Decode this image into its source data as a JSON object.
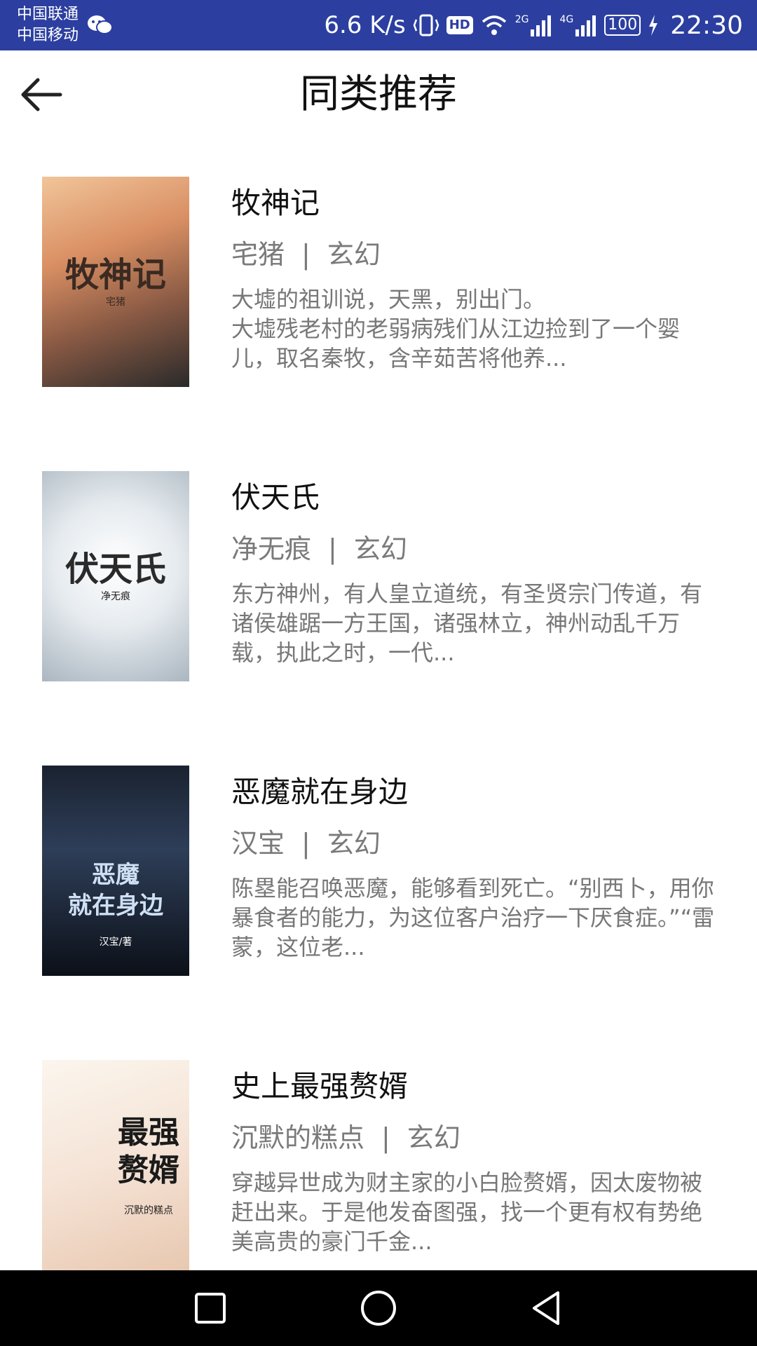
{
  "status_bar": {
    "carrier1": "中国联通",
    "carrier2": "中国移动",
    "speed": "6.6 K/s",
    "battery": "100",
    "time": "22:30",
    "hd_badge": "HD",
    "signal_2g": "2G",
    "signal_4g": "4G",
    "icons": [
      "wechat-icon",
      "vibrate-icon",
      "hd-icon",
      "wifi-icon",
      "signal-icon",
      "battery-icon",
      "charging-icon"
    ]
  },
  "header": {
    "title": "同类推荐",
    "back_icon": "arrow-left-icon"
  },
  "books": [
    {
      "title": "牧神记",
      "author": "宅猪",
      "separator": "|",
      "genre": "玄幻",
      "desc": "大墟的祖训说，天黑，别出门。\n大墟残老村的老弱病残们从江边捡到了一个婴儿，取名秦牧，含辛茹苦将他养...",
      "cover_text": "牧神记",
      "cover_author": "宅猪",
      "cover_colors": [
        "#e9b07a",
        "#b86a4a",
        "#2a2a2a"
      ]
    },
    {
      "title": "伏天氏",
      "author": "净无痕",
      "separator": "|",
      "genre": "玄幻",
      "desc": "东方神州，有人皇立道统，有圣贤宗门传道，有诸侯雄踞一方王国，诸强林立，神州动乱千万载，执此之时，一代...",
      "cover_text": "伏天氏",
      "cover_author": "净无痕",
      "cover_colors": [
        "#f2f4f6",
        "#c9d1d8",
        "#8a98a4"
      ]
    },
    {
      "title": "恶魔就在身边",
      "author": "汉宝",
      "separator": "|",
      "genre": "玄幻",
      "desc": "陈塁能召唤恶魔，能够看到死亡。“别西卜，用你暴食者的能力，为这位客户治疗一下厌食症。”“雷蒙，这位老...",
      "cover_text": "恶魔\n就在身边",
      "cover_author": "汉宝/著",
      "cover_colors": [
        "#0c1018",
        "#2a3a52",
        "#9fb8d8"
      ]
    },
    {
      "title": "史上最强赘婿",
      "author": "沉默的糕点",
      "separator": "|",
      "genre": "玄幻",
      "desc": "穿越异世成为财主家的小白脸赘婿，因太废物被赶出来。于是他发奋图强，找一个更有权有势绝美高贵的豪门千金...",
      "cover_text": "最强\n赘婿",
      "cover_author": "沉默的糕点",
      "cover_colors": [
        "#fbf6ee",
        "#f2d6c6",
        "#c9a07a"
      ]
    }
  ],
  "nav_bar": {
    "buttons": [
      "recents-square-icon",
      "home-circle-icon",
      "back-triangle-icon"
    ]
  }
}
